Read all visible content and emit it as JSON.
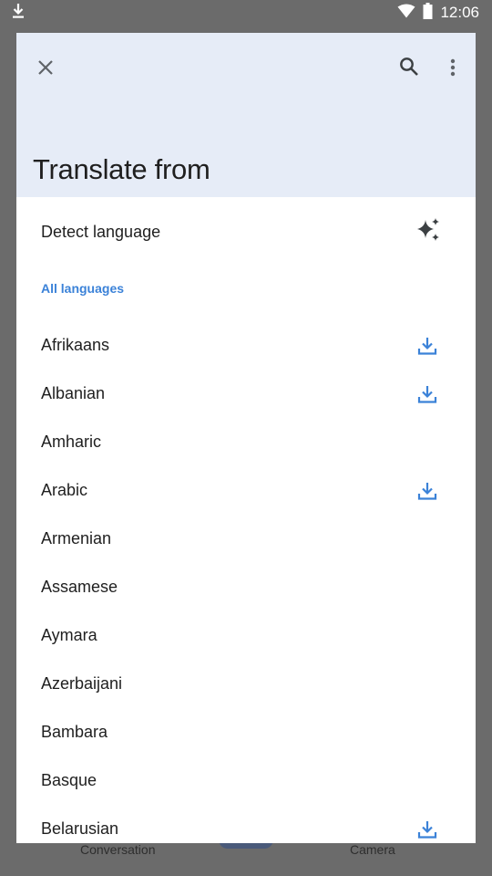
{
  "status_bar": {
    "time": "12:06",
    "icons": [
      "download-icon",
      "wifi-icon",
      "battery-icon"
    ]
  },
  "background": {
    "nav": [
      {
        "label": "Conversation"
      },
      {
        "label": "Camera"
      }
    ]
  },
  "sheet": {
    "title": "Translate from",
    "header_icons": [
      "close-icon",
      "search-icon",
      "more-vert-icon"
    ],
    "detect": {
      "label": "Detect language",
      "icon": "sparkle-icon"
    },
    "section_label": "All languages",
    "languages": [
      {
        "label": "Afrikaans",
        "downloadable": true
      },
      {
        "label": "Albanian",
        "downloadable": true
      },
      {
        "label": "Amharic",
        "downloadable": false
      },
      {
        "label": "Arabic",
        "downloadable": true
      },
      {
        "label": "Armenian",
        "downloadable": false
      },
      {
        "label": "Assamese",
        "downloadable": false
      },
      {
        "label": "Aymara",
        "downloadable": false
      },
      {
        "label": "Azerbaijani",
        "downloadable": false
      },
      {
        "label": "Bambara",
        "downloadable": false
      },
      {
        "label": "Basque",
        "downloadable": false
      },
      {
        "label": "Belarusian",
        "downloadable": true
      }
    ]
  },
  "colors": {
    "header_bg": "#e6ecf7",
    "accent": "#3b82d8",
    "scrim": "#6b6b6b",
    "text": "#1f1f1f"
  }
}
